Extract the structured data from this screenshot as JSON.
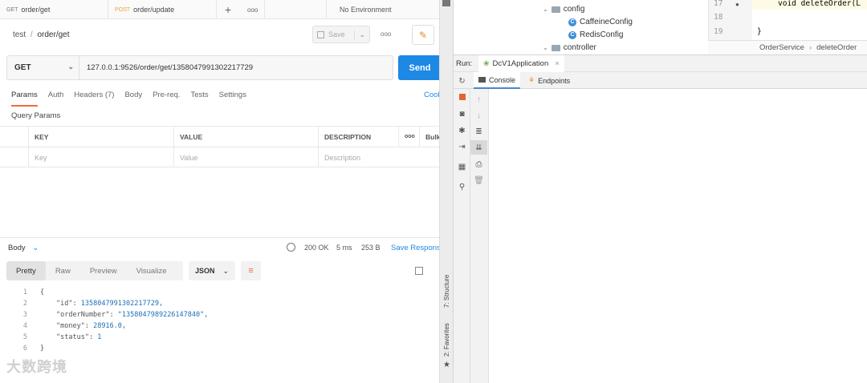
{
  "postman": {
    "tabs": [
      {
        "method": "GET",
        "name": "order/get"
      },
      {
        "method": "POST",
        "name": "order/update"
      }
    ],
    "new_tab": "+",
    "more_tabs": "ooo",
    "environment": "No Environment",
    "breadcrumb": {
      "collection": "test",
      "separator": "/",
      "request": "order/get"
    },
    "save_label": "Save",
    "more": "ooo",
    "method": "GET",
    "url": "127.0.0.1:9526/order/get/1358047991302217729",
    "send_label": "Send",
    "request_tabs": [
      "Params",
      "Auth",
      "Headers (7)",
      "Body",
      "Pre-req.",
      "Tests",
      "Settings"
    ],
    "cookies_label": "Cookies",
    "query_params_title": "Query Params",
    "params_columns": {
      "key": "KEY",
      "value": "VALUE",
      "description": "DESCRIPTION",
      "more": "ooo",
      "bulk": "Bulk Edit"
    },
    "params_placeholders": {
      "key": "Key",
      "value": "Value",
      "description": "Description"
    },
    "response": {
      "body_label": "Body",
      "status": "200 OK",
      "time": "5 ms",
      "size": "253 B",
      "save_label": "Save Response",
      "view_tabs": [
        "Pretty",
        "Raw",
        "Preview",
        "Visualize"
      ],
      "format": "JSON",
      "lines": [
        {
          "n": "1",
          "text": "{"
        },
        {
          "n": "2",
          "key": "\"id\"",
          "value": "1358047991302217729,"
        },
        {
          "n": "3",
          "key": "\"orderNumber\"",
          "value": "\"1358047989226147840\","
        },
        {
          "n": "4",
          "key": "\"money\"",
          "value": "28916.0,"
        },
        {
          "n": "5",
          "key": "\"status\"",
          "value": "1"
        },
        {
          "n": "6",
          "text": "}"
        }
      ]
    },
    "watermark": "大数跨境"
  },
  "ide": {
    "tree": {
      "config_folder": "config",
      "items": [
        "CaffeineConfig",
        "RedisConfig"
      ],
      "controller_folder": "controller"
    },
    "editor": {
      "lines": [
        {
          "n": "17",
          "code": "void deleteOrder(L"
        },
        {
          "n": "18",
          "code": ""
        },
        {
          "n": "19",
          "code": "}"
        }
      ],
      "breadcrumb": [
        "OrderService",
        "›",
        "deleteOrder"
      ]
    },
    "run_label": "Run:",
    "run_config": "DcV1Application",
    "close": "×",
    "subtabs": [
      "Console",
      "Endpoints"
    ],
    "side_labels": [
      "7: Structure",
      "2: Favorites"
    ]
  },
  "colors": {
    "send": "#1e88e5",
    "active_tab_underline": "#f26b3a",
    "json_value": "#1c6fb8",
    "post_method": "#e8a33d"
  }
}
